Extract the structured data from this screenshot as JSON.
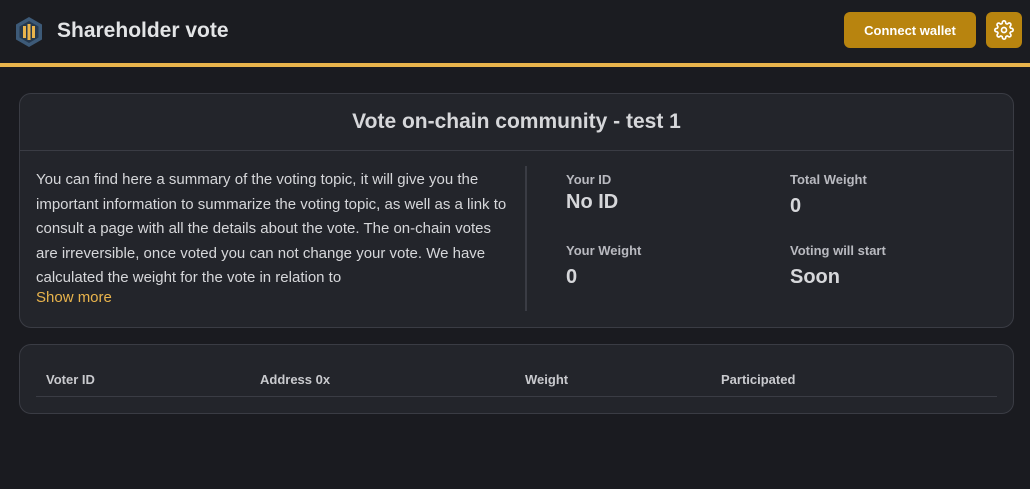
{
  "header": {
    "app_title": "Shareholder vote",
    "connect_wallet_label": "Connect wallet",
    "icons": {
      "logo": "hexagon-logo-icon",
      "settings": "gear-icon"
    },
    "colors": {
      "accent": "#e9b44c",
      "button": "#b8840f"
    }
  },
  "vote": {
    "title": "Vote on-chain community - test 1",
    "description": "You can find here a summary of the voting topic, it will give you the important information to summarize the voting topic, as well as a link to consult a page with all the details about the vote. The on-chain votes are irreversible, once voted you can not change your vote. We have calculated the weight for the vote in relation to",
    "show_more_label": "Show more",
    "stats": {
      "your_id": {
        "label": "Your ID",
        "value": "No ID"
      },
      "total_weight": {
        "label": "Total Weight",
        "value": "0"
      },
      "your_weight": {
        "label": "Your Weight",
        "value": "0"
      },
      "voting_start": {
        "label": "Voting will start",
        "value": "Soon"
      }
    }
  },
  "voters_table": {
    "columns": [
      "Voter ID",
      "Address 0x",
      "Weight",
      "Participated"
    ],
    "rows": []
  }
}
